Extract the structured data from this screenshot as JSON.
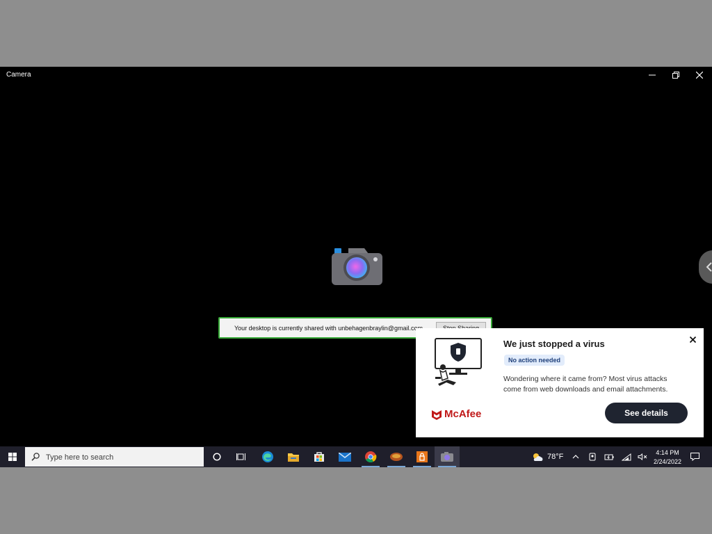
{
  "window": {
    "title": "Camera",
    "controls": [
      "minimize-icon",
      "restore-icon",
      "close-icon"
    ]
  },
  "share_bar": {
    "message": "Your desktop is currently shared with unbehagenbraylin@gmail.com",
    "button_label": "Stop Sharing"
  },
  "toast": {
    "title": "We just stopped a virus",
    "badge": "No action needed",
    "body": "Wondering where it came from? Most virus attacks come from web downloads and email attachments.",
    "brand": "McAfee",
    "action_label": "See details",
    "brand_color": "#c01818"
  },
  "taskbar": {
    "search_placeholder": "Type here to search",
    "pinned": [
      "cortana-icon",
      "task-view-icon",
      "edge-icon",
      "file-explorer-icon",
      "store-icon",
      "mail-icon",
      "chrome-icon",
      "app-icon",
      "app-icon-2",
      "camera-icon"
    ],
    "weather": "78°F",
    "time": "4:14 PM",
    "date": "2/24/2022"
  }
}
